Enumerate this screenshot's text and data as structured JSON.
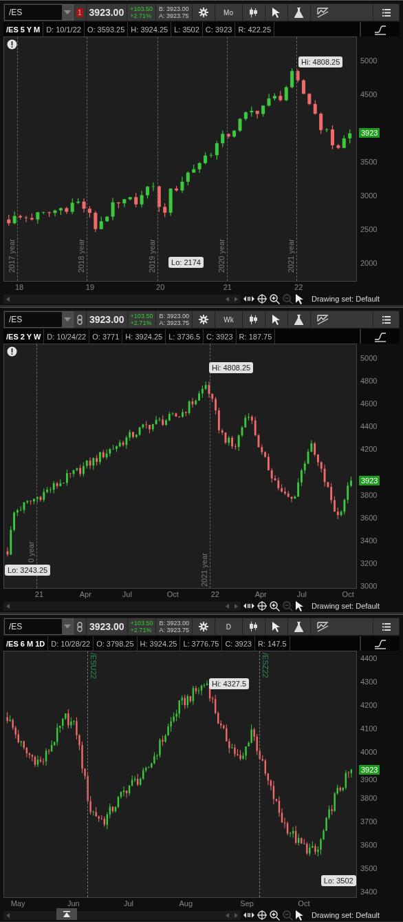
{
  "panels": [
    {
      "symbol": "/ES",
      "alert": {
        "kind": "badge",
        "text": "1"
      },
      "price": "3923.00",
      "net_change": "+103.50",
      "percent_change": "+2.71%",
      "bid": "B: 3923.00",
      "ask": "A: 3923.75",
      "interval": "Mo",
      "title": "/ES 5 Y M",
      "fields": [
        "D: 10/1/22",
        "O: 3593.25",
        "H: 3924.25",
        "L: 3502",
        "C: 3923",
        "R: 422.25"
      ],
      "note": true,
      "y_labels": [
        "5000",
        "4500",
        "3500",
        "3000",
        "2500",
        "2000"
      ],
      "x_labels": [
        "18",
        "19",
        "20",
        "21",
        "22"
      ],
      "markers": [
        {
          "label": "2017 year",
          "kind": "year"
        },
        {
          "label": "2018 year",
          "kind": "year"
        },
        {
          "label": "2019 year",
          "kind": "year"
        },
        {
          "label": "2020 year",
          "kind": "year"
        },
        {
          "label": "2021 year",
          "kind": "year"
        }
      ],
      "hi": "Hi: 4808.25",
      "lo": "Lo: 2174",
      "last_badge": "3923",
      "collapse_button": false,
      "zoom_out_disabled": true,
      "drawing_set": "Drawing set: Default"
    },
    {
      "symbol": "/ES",
      "alert": {
        "kind": "link"
      },
      "price": "3923.00",
      "net_change": "+103.50",
      "percent_change": "+2.71%",
      "bid": "B: 3923.00",
      "ask": "A: 3923.75",
      "interval": "Wk",
      "title": "/ES 2 Y W",
      "fields": [
        "D: 10/24/22",
        "O: 3771",
        "H: 3924.25",
        "L: 3736.5",
        "C: 3923",
        "R: 187.75"
      ],
      "note": true,
      "y_labels": [
        "5000",
        "4800",
        "4600",
        "4400",
        "4200",
        "3800",
        "3600",
        "3400",
        "3200",
        "3000"
      ],
      "x_labels": [
        "21",
        "Apr",
        "Jul",
        "Oct",
        "22",
        "Apr",
        "Jul",
        "Oct"
      ],
      "markers": [
        {
          "label": "0 year",
          "kind": "year"
        },
        {
          "label": "2021 year",
          "kind": "year"
        }
      ],
      "hi": "Hi: 4808.25",
      "lo": "Lo: 3243.25",
      "last_badge": "3923",
      "collapse_button": false,
      "zoom_out_disabled": true,
      "drawing_set": "Drawing set: Default"
    },
    {
      "symbol": "/ES",
      "alert": {
        "kind": "link"
      },
      "price": "3923.00",
      "net_change": "+103.50",
      "percent_change": "+2.71%",
      "bid": "B: 3923.00",
      "ask": "A: 3923.75",
      "interval": "D",
      "title": "/ES 6 M 1D",
      "fields": [
        "D: 10/28/22",
        "O: 3798.25",
        "H: 3924.25",
        "L: 3776.75",
        "C: 3923",
        "R: 147.5"
      ],
      "note": false,
      "y_labels": [
        "4400",
        "4300",
        "4200",
        "4100",
        "4000",
        "3900",
        "3800",
        "3700",
        "3600",
        "3500",
        "3400"
      ],
      "x_labels": [
        "May",
        "Jun",
        "Jul",
        "Aug",
        "Sep",
        "Oct"
      ],
      "markers": [
        {
          "label": "/ESU22",
          "kind": "contract"
        },
        {
          "label": "/ESZ22",
          "kind": "contract"
        }
      ],
      "hi": "Hi: 4327.5",
      "lo": "Lo: 3502",
      "last_badge": "3923",
      "collapse_button": true,
      "zoom_out_disabled": true,
      "drawing_set": "Drawing set: Default"
    }
  ]
}
